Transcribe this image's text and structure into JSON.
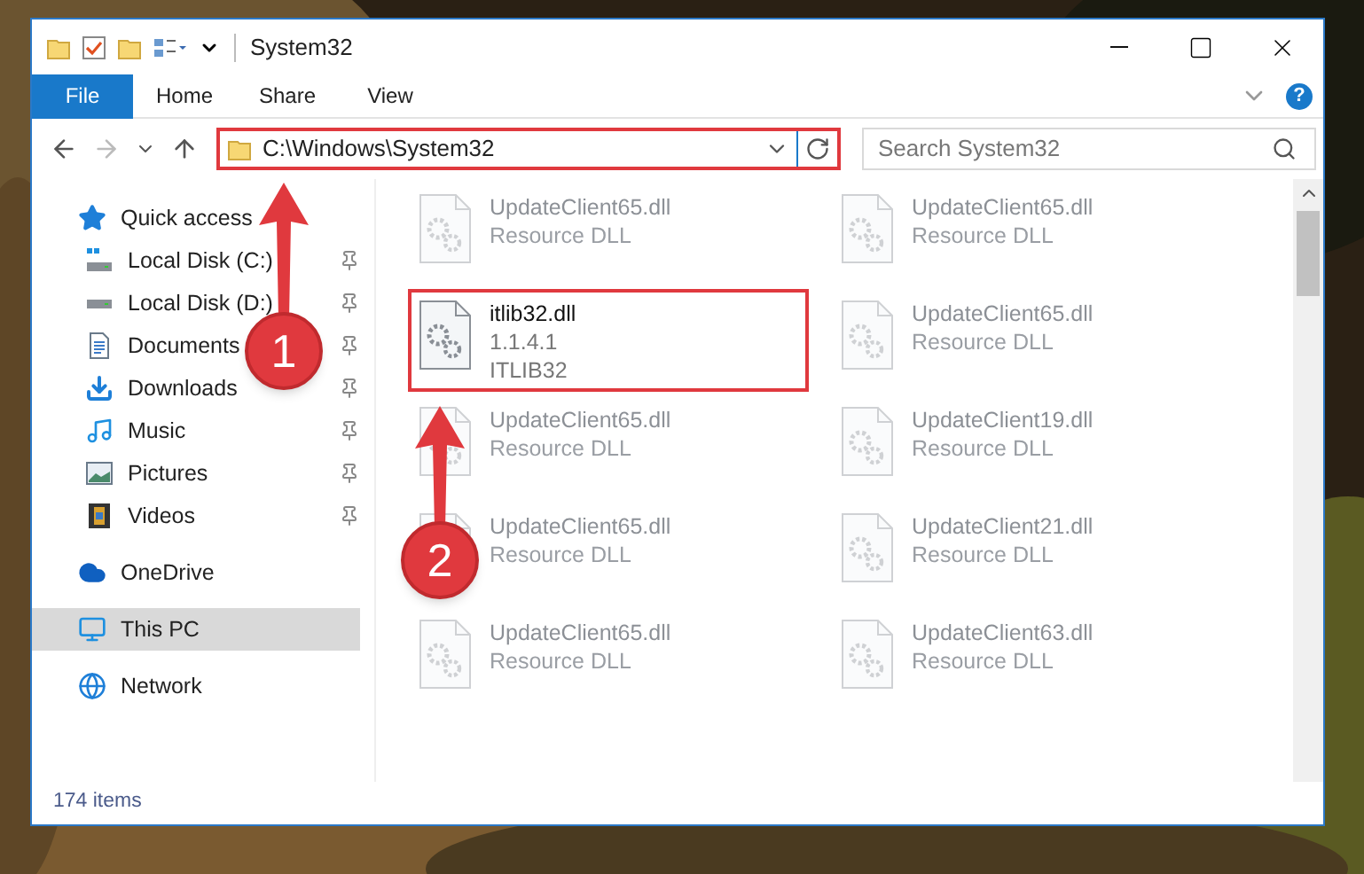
{
  "window": {
    "title": "System32"
  },
  "ribbon": {
    "tabs": [
      {
        "label": "File",
        "selected": true
      },
      {
        "label": "Home",
        "selected": false
      },
      {
        "label": "Share",
        "selected": false
      },
      {
        "label": "View",
        "selected": false
      }
    ],
    "help": "?"
  },
  "address_bar": {
    "path": "C:\\Windows\\System32"
  },
  "search": {
    "placeholder": "Search System32"
  },
  "sidebar": {
    "items": [
      {
        "label": "Quick access",
        "selected": false,
        "children": [
          {
            "label": "Local Disk (C:)",
            "pinned": true
          },
          {
            "label": "Local Disk (D:)",
            "pinned": true
          },
          {
            "label": "Documents",
            "pinned": true
          },
          {
            "label": "Downloads",
            "pinned": true
          },
          {
            "label": "Music",
            "pinned": true
          },
          {
            "label": "Pictures",
            "pinned": true
          },
          {
            "label": "Videos",
            "pinned": true
          }
        ]
      },
      {
        "label": "OneDrive",
        "selected": false
      },
      {
        "label": "This PC",
        "selected": true
      },
      {
        "label": "Network",
        "selected": false
      }
    ]
  },
  "files": [
    {
      "name": "UpdateClient65.dll",
      "details": [
        "Resource DLL"
      ],
      "dimmed": true
    },
    {
      "name": "UpdateClient65.dll",
      "details": [
        "Resource DLL"
      ],
      "dimmed": true
    },
    {
      "name": "itlib32.dll",
      "details": [
        "1.1.4.1",
        "ITLIB32"
      ],
      "dimmed": false
    },
    {
      "name": "UpdateClient65.dll",
      "details": [
        "Resource DLL"
      ],
      "dimmed": true
    },
    {
      "name": "UpdateClient65.dll",
      "details": [
        "Resource DLL"
      ],
      "dimmed": true
    },
    {
      "name": "UpdateClient19.dll",
      "details": [
        "Resource DLL"
      ],
      "dimmed": true
    },
    {
      "name": "UpdateClient65.dll",
      "details": [
        "Resource DLL"
      ],
      "dimmed": true
    },
    {
      "name": "UpdateClient21.dll",
      "details": [
        "Resource DLL"
      ],
      "dimmed": true
    },
    {
      "name": "UpdateClient65.dll",
      "details": [
        "Resource DLL"
      ],
      "dimmed": true
    },
    {
      "name": "UpdateClient63.dll",
      "details": [
        "Resource DLL"
      ],
      "dimmed": true
    }
  ],
  "status_bar": {
    "item_count": "174 items"
  },
  "annotations": [
    {
      "kind": "callout",
      "label": "1"
    },
    {
      "kind": "callout",
      "label": "2"
    }
  ]
}
